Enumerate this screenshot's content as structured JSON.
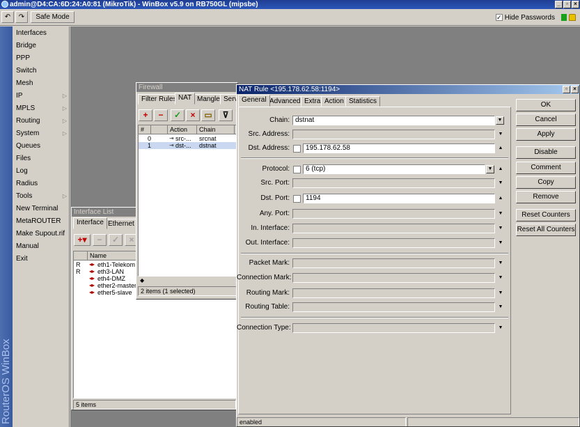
{
  "window": {
    "title": "admin@D4:CA:6D:24:A0:81 (MikroTik) - WinBox v5.9 on RB750GL (mipsbe)"
  },
  "toolbar": {
    "safe_mode_label": "Safe Mode",
    "hide_passwords_label": "Hide Passwords",
    "hide_passwords_checked": "✓"
  },
  "sidebar": {
    "brand": "RouterOS WinBox",
    "items": [
      {
        "label": "Interfaces",
        "submenu": ""
      },
      {
        "label": "Bridge",
        "submenu": ""
      },
      {
        "label": "PPP",
        "submenu": ""
      },
      {
        "label": "Switch",
        "submenu": ""
      },
      {
        "label": "Mesh",
        "submenu": ""
      },
      {
        "label": "IP",
        "submenu": "▷"
      },
      {
        "label": "MPLS",
        "submenu": "▷"
      },
      {
        "label": "Routing",
        "submenu": "▷"
      },
      {
        "label": "System",
        "submenu": "▷"
      },
      {
        "label": "Queues",
        "submenu": ""
      },
      {
        "label": "Files",
        "submenu": ""
      },
      {
        "label": "Log",
        "submenu": ""
      },
      {
        "label": "Radius",
        "submenu": ""
      },
      {
        "label": "Tools",
        "submenu": "▷"
      },
      {
        "label": "New Terminal",
        "submenu": ""
      },
      {
        "label": "MetaROUTER",
        "submenu": ""
      },
      {
        "label": "Make Supout.rif",
        "submenu": ""
      },
      {
        "label": "Manual",
        "submenu": ""
      },
      {
        "label": "Exit",
        "submenu": ""
      }
    ]
  },
  "interface_list": {
    "title": "Interface List",
    "tabs": [
      "Interface",
      "Ethernet"
    ],
    "column_name": "Name",
    "rows": [
      {
        "flag": "R",
        "name": "eth1-Telekom"
      },
      {
        "flag": "R",
        "name": "eth3-LAN"
      },
      {
        "flag": "",
        "name": "eth4-DMZ"
      },
      {
        "flag": "",
        "name": "ether2-master"
      },
      {
        "flag": "",
        "name": "ether5-slave"
      }
    ],
    "status": "5 items"
  },
  "firewall": {
    "title": "Firewall",
    "tabs": [
      "Filter Rules",
      "NAT",
      "Mangle",
      "Serv"
    ],
    "columns": [
      "#",
      "",
      "Action",
      "Chain"
    ],
    "rows": [
      {
        "num": "0",
        "action": "src-...",
        "chain": "srcnat"
      },
      {
        "num": "1",
        "action": "dst-...",
        "chain": "dstnat"
      }
    ],
    "status": "2 items (1 selected)"
  },
  "nat_rule": {
    "title": "NAT Rule <195.178.62.58:1194>",
    "tabs": [
      "General",
      "Advanced",
      "Extra",
      "Action",
      "Statistics"
    ],
    "fields": {
      "chain": {
        "label": "Chain:",
        "value": "dstnat"
      },
      "src_address": {
        "label": "Src. Address:",
        "value": ""
      },
      "dst_address": {
        "label": "Dst. Address:",
        "value": "195.178.62.58"
      },
      "protocol": {
        "label": "Protocol:",
        "value": "6 (tcp)"
      },
      "src_port": {
        "label": "Src. Port:",
        "value": ""
      },
      "dst_port": {
        "label": "Dst. Port:",
        "value": "1194"
      },
      "any_port": {
        "label": "Any. Port:",
        "value": ""
      },
      "in_interface": {
        "label": "In. Interface:",
        "value": ""
      },
      "out_interface": {
        "label": "Out. Interface:",
        "value": ""
      },
      "packet_mark": {
        "label": "Packet Mark:",
        "value": ""
      },
      "connection_mark": {
        "label": "Connection Mark:",
        "value": ""
      },
      "routing_mark": {
        "label": "Routing Mark:",
        "value": ""
      },
      "routing_table": {
        "label": "Routing Table:",
        "value": ""
      },
      "connection_type": {
        "label": "Connection Type:",
        "value": ""
      }
    },
    "buttons": [
      "OK",
      "Cancel",
      "Apply",
      "Disable",
      "Comment",
      "Copy",
      "Remove",
      "Reset Counters",
      "Reset All Counters"
    ],
    "status": "enabled"
  }
}
